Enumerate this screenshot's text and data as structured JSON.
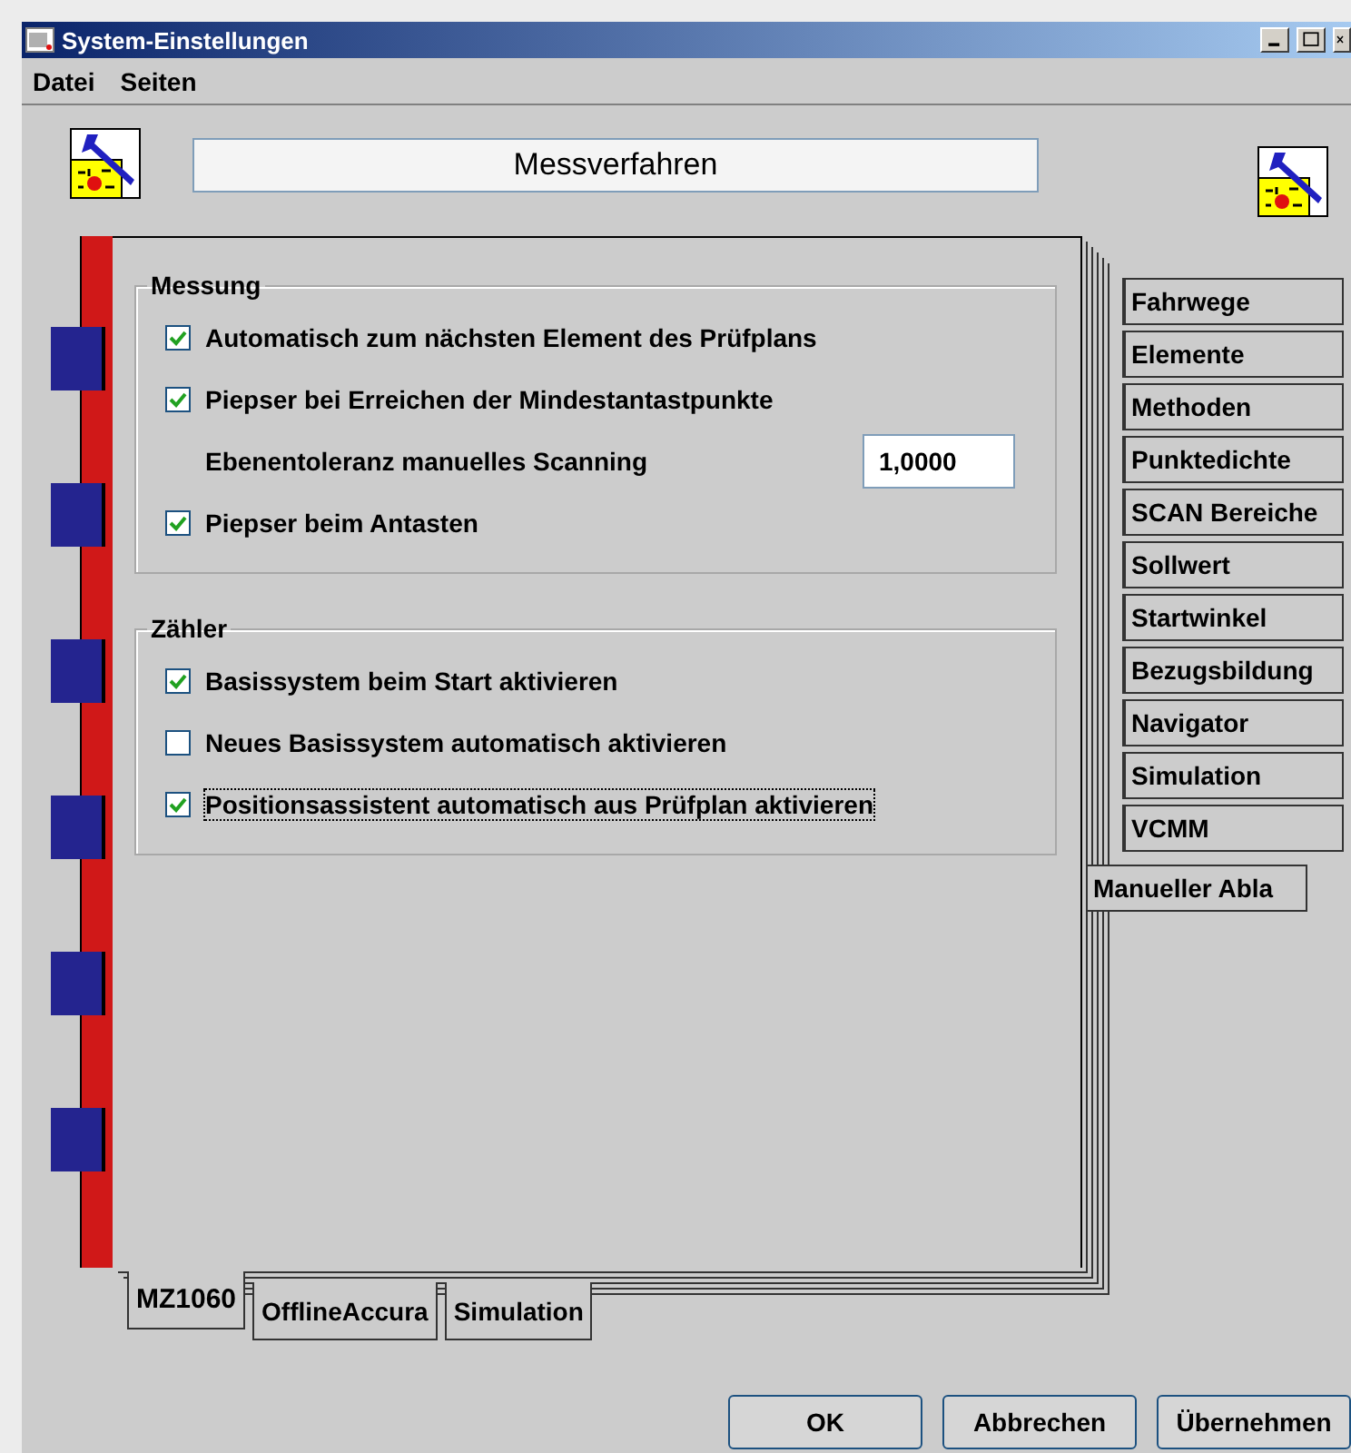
{
  "window": {
    "title": "System-Einstellungen"
  },
  "menu": [
    "Datei",
    "Seiten"
  ],
  "header": {
    "title": "Messverfahren"
  },
  "groups": [
    {
      "title": "Messung",
      "items": [
        {
          "kind": "checkbox",
          "label": "Automatisch zum nächsten Element des Prüfplans",
          "checked": true,
          "focused": false
        },
        {
          "kind": "checkbox",
          "label": "Piepser bei Erreichen der Mindestantastpunkte",
          "checked": true,
          "focused": false
        },
        {
          "kind": "number",
          "label": "Ebenentoleranz manuelles Scanning",
          "value": "1,0000"
        },
        {
          "kind": "checkbox",
          "label": "Piepser beim Antasten",
          "checked": true,
          "focused": false
        }
      ]
    },
    {
      "title": "Zähler",
      "items": [
        {
          "kind": "checkbox",
          "label": "Basissystem beim Start aktivieren",
          "checked": true,
          "focused": false
        },
        {
          "kind": "checkbox",
          "label": "Neues Basissystem automatisch aktivieren",
          "checked": false,
          "focused": false
        },
        {
          "kind": "checkbox",
          "label": "Positionsassistent automatisch aus Prüfplan aktivieren",
          "checked": true,
          "focused": true
        }
      ]
    }
  ],
  "side_tabs": [
    {
      "label": "Fahrwege",
      "selected": false
    },
    {
      "label": "Elemente",
      "selected": false
    },
    {
      "label": "Methoden",
      "selected": false
    },
    {
      "label": "Punktedichte",
      "selected": false
    },
    {
      "label": "SCAN Bereiche",
      "selected": false
    },
    {
      "label": "Sollwert",
      "selected": false
    },
    {
      "label": "Startwinkel",
      "selected": false
    },
    {
      "label": "Bezugsbildung",
      "selected": false
    },
    {
      "label": "Navigator",
      "selected": false
    },
    {
      "label": "Simulation",
      "selected": false
    },
    {
      "label": "VCMM",
      "selected": false
    },
    {
      "label": "Manueller Abla",
      "selected": true
    }
  ],
  "bottom_tabs": [
    {
      "label": "MZ1060",
      "selected": true
    },
    {
      "label": "OfflineAccura",
      "selected": false
    },
    {
      "label": "Simulation",
      "selected": false
    }
  ],
  "buttons": [
    "OK",
    "Abbrechen",
    "Übernehmen"
  ]
}
